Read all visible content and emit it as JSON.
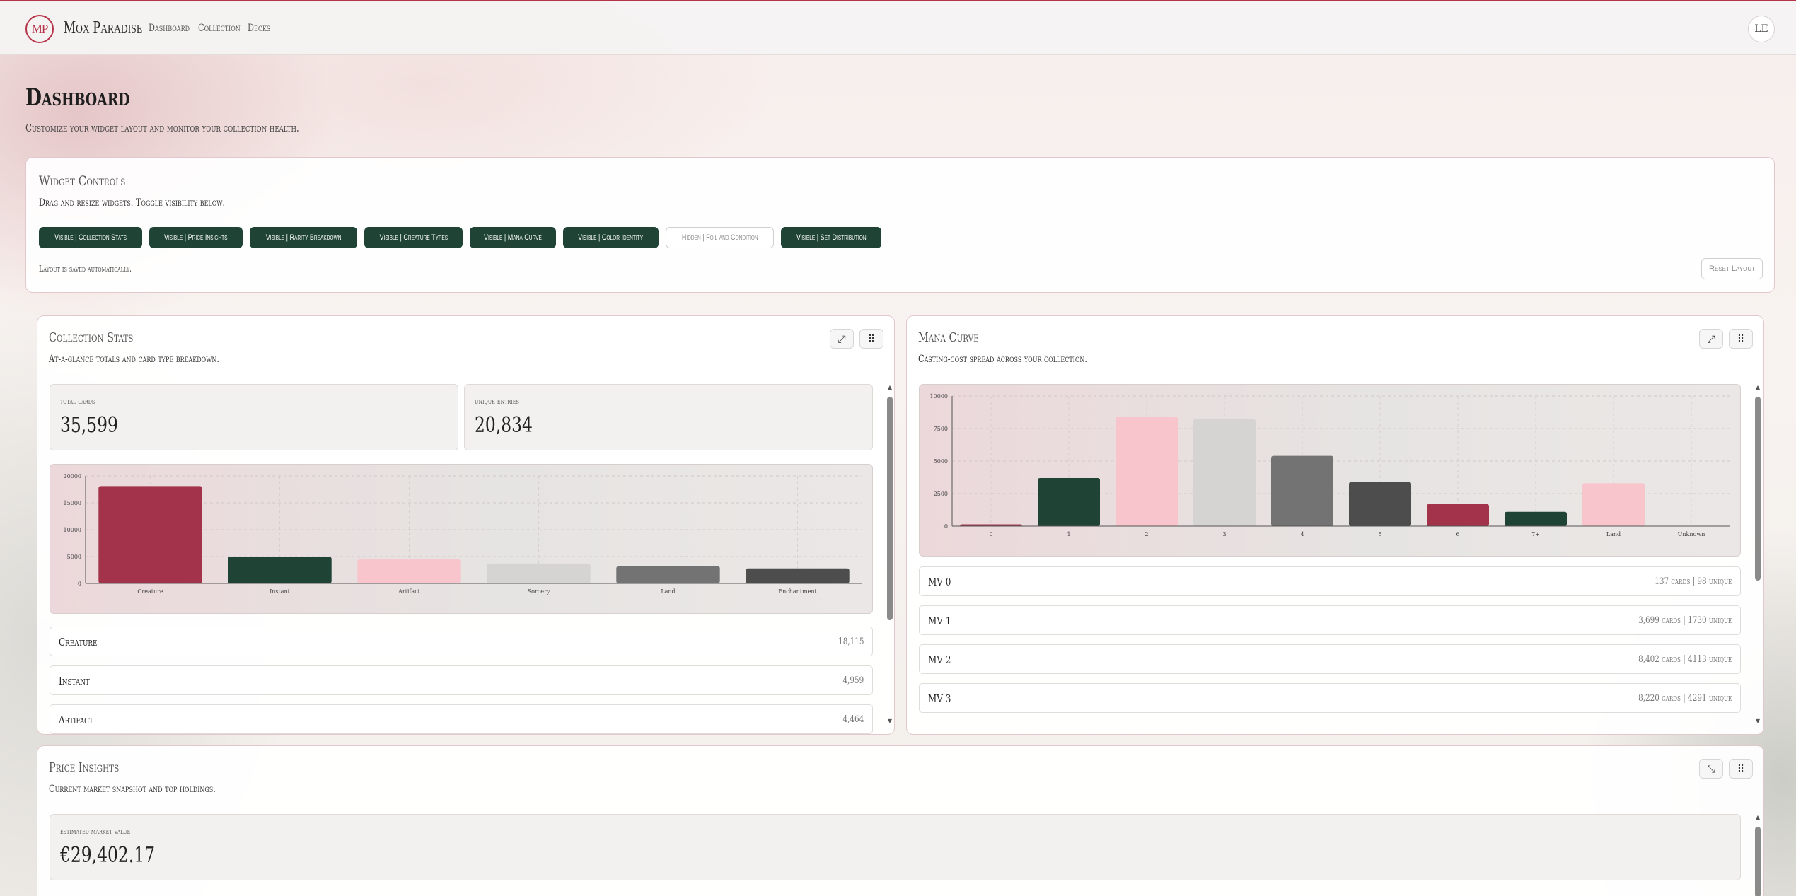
{
  "app": {
    "logo": "MP",
    "name": "Mox Paradise",
    "avatar": "LE"
  },
  "nav": [
    "Dashboard",
    "Collection",
    "Decks"
  ],
  "page": {
    "title": "Dashboard",
    "subtitle": "Customize your widget layout and monitor your collection health."
  },
  "controls": {
    "title": "Widget Controls",
    "description": "Drag and resize widgets. Toggle visibility below.",
    "chips": [
      {
        "label": "Visible | Collection Stats",
        "state": "on"
      },
      {
        "label": "Visible | Price Insights",
        "state": "on"
      },
      {
        "label": "Visible | Rarity Breakdown",
        "state": "on"
      },
      {
        "label": "Visible | Creature Types",
        "state": "on"
      },
      {
        "label": "Visible | Mana Curve",
        "state": "on"
      },
      {
        "label": "Visible | Color Identity",
        "state": "on"
      },
      {
        "label": "Hidden | Foil and Condition",
        "state": "off"
      },
      {
        "label": "Visible | Set Distribution",
        "state": "on"
      }
    ],
    "note": "Layout is saved automatically.",
    "reset_label": "Reset Layout"
  },
  "collection_stats": {
    "title": "Collection Stats",
    "description": "At-a-glance totals and card type breakdown.",
    "total_label": "total cards",
    "total_value": "35,599",
    "unique_label": "unique entries",
    "unique_value": "20,834",
    "rows": [
      {
        "label": "Creature",
        "value": "18,115"
      },
      {
        "label": "Instant",
        "value": "4,959"
      },
      {
        "label": "Artifact",
        "value": "4,464"
      }
    ]
  },
  "mana_curve": {
    "title": "Mana Curve",
    "description": "Casting-cost spread across your collection.",
    "rows": [
      {
        "label": "MV 0",
        "value": "137 cards | 98 unique"
      },
      {
        "label": "MV 1",
        "value": "3,699 cards | 1730 unique"
      },
      {
        "label": "MV 2",
        "value": "8,402 cards | 4113 unique"
      },
      {
        "label": "MV 3",
        "value": "8,220 cards | 4291 unique"
      }
    ]
  },
  "price_insights": {
    "title": "Price Insights",
    "description": "Current market snapshot and top holdings.",
    "market_label": "estimated market value",
    "market_value": "€29,402.17"
  },
  "colors": {
    "crimson": "#a3334a",
    "forest": "#1f4436",
    "pink": "#f9c5cc",
    "lightgray": "#d6d4d2",
    "gray": "#737373",
    "darkgray": "#4d4d4d"
  },
  "chart_data": [
    {
      "type": "bar",
      "categories": [
        "Creature",
        "Instant",
        "Artifact",
        "Sorcery",
        "Land",
        "Enchantment"
      ],
      "values": [
        18115,
        4959,
        4464,
        3700,
        3200,
        2800
      ],
      "colors": [
        "#a3334a",
        "#1f4436",
        "#f9c5cc",
        "#d6d4d2",
        "#737373",
        "#4d4d4d"
      ],
      "ylim": [
        0,
        20000
      ],
      "yticks": [
        0,
        5000,
        10000,
        15000,
        20000
      ],
      "grid": true
    },
    {
      "type": "bar",
      "categories": [
        "0",
        "1",
        "2",
        "3",
        "4",
        "5",
        "6",
        "7+",
        "Land",
        "Unknown"
      ],
      "values": [
        137,
        3699,
        8402,
        8220,
        5400,
        3400,
        1700,
        1100,
        3300,
        0
      ],
      "colors": [
        "#a3334a",
        "#1f4436",
        "#f9c5cc",
        "#d6d4d2",
        "#737373",
        "#4d4d4d",
        "#a3334a",
        "#1f4436",
        "#f9c5cc",
        "#d6d4d2"
      ],
      "ylim": [
        0,
        10000
      ],
      "yticks": [
        0,
        2500,
        5000,
        7500,
        10000
      ],
      "grid": true
    }
  ]
}
